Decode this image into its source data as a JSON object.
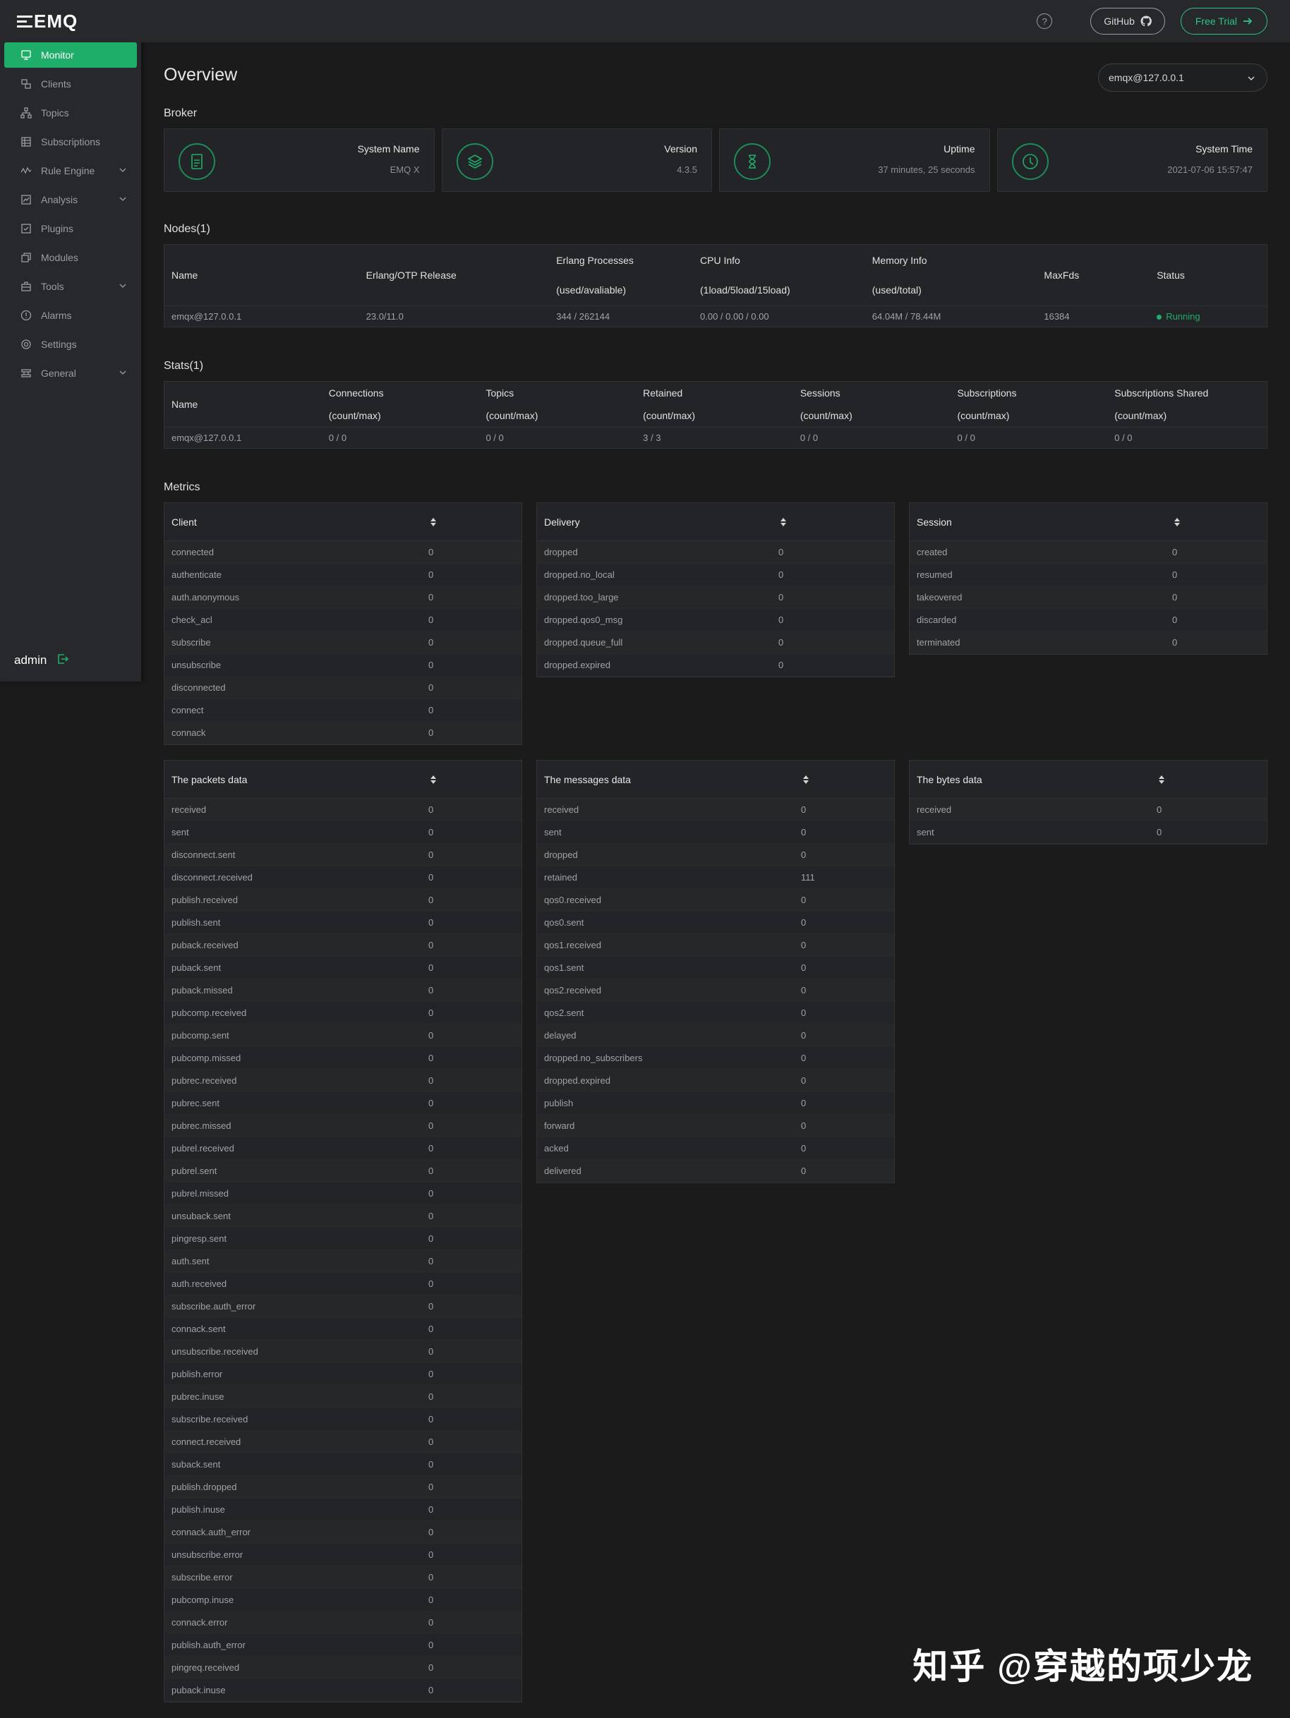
{
  "logo": "EMQ",
  "nav": [
    {
      "label": "Monitor",
      "icon": "monitor-icon",
      "active": true,
      "caret": false
    },
    {
      "label": "Clients",
      "icon": "clients-icon",
      "active": false,
      "caret": false
    },
    {
      "label": "Topics",
      "icon": "topics-icon",
      "active": false,
      "caret": false
    },
    {
      "label": "Subscriptions",
      "icon": "subscriptions-icon",
      "active": false,
      "caret": false
    },
    {
      "label": "Rule Engine",
      "icon": "rule-engine-icon",
      "active": false,
      "caret": true
    },
    {
      "label": "Analysis",
      "icon": "analysis-icon",
      "active": false,
      "caret": true
    },
    {
      "label": "Plugins",
      "icon": "plugins-icon",
      "active": false,
      "caret": false
    },
    {
      "label": "Modules",
      "icon": "modules-icon",
      "active": false,
      "caret": false
    },
    {
      "label": "Tools",
      "icon": "tools-icon",
      "active": false,
      "caret": true
    },
    {
      "label": "Alarms",
      "icon": "alarms-icon",
      "active": false,
      "caret": false
    },
    {
      "label": "Settings",
      "icon": "settings-icon",
      "active": false,
      "caret": false
    },
    {
      "label": "General",
      "icon": "general-icon",
      "active": false,
      "caret": true
    }
  ],
  "user": {
    "name": "admin",
    "logout_icon": "logout-icon"
  },
  "topbar": {
    "help": "?",
    "github": "GitHub",
    "trial": "Free Trial"
  },
  "page": {
    "title": "Overview",
    "node": "emqx@127.0.0.1"
  },
  "broker": {
    "label": "Broker",
    "cards": [
      {
        "label": "System Name",
        "value": "EMQ X",
        "icon": "document-icon"
      },
      {
        "label": "Version",
        "value": "4.3.5",
        "icon": "layers-icon"
      },
      {
        "label": "Uptime",
        "value": "37 minutes, 25 seconds",
        "icon": "hourglass-icon"
      },
      {
        "label": "System Time",
        "value": "2021-07-06 15:57:47",
        "icon": "clock-icon"
      }
    ]
  },
  "nodes": {
    "label": "Nodes(1)",
    "headers": [
      [
        "Name"
      ],
      [
        "Erlang/OTP Release"
      ],
      [
        "Erlang Processes",
        "(used/avaliable)"
      ],
      [
        "CPU Info",
        "(1load/5load/15load)"
      ],
      [
        "Memory Info",
        "(used/total)"
      ],
      [
        "MaxFds"
      ],
      [
        "Status"
      ]
    ],
    "rows": [
      [
        "emqx@127.0.0.1",
        "23.0/11.0",
        "344 / 262144",
        "0.00 / 0.00 / 0.00",
        "64.04M / 78.44M",
        "16384",
        "Running"
      ]
    ]
  },
  "stats": {
    "label": "Stats(1)",
    "headers": [
      [
        "Name"
      ],
      [
        "Connections",
        "(count/max)"
      ],
      [
        "Topics",
        "(count/max)"
      ],
      [
        "Retained",
        "(count/max)"
      ],
      [
        "Sessions",
        "(count/max)"
      ],
      [
        "Subscriptions",
        "(count/max)"
      ],
      [
        "Subscriptions Shared",
        "(count/max)"
      ]
    ],
    "rows": [
      [
        "emqx@127.0.0.1",
        "0 / 0",
        "0 / 0",
        "3 / 3",
        "0 / 0",
        "0 / 0",
        "0 / 0"
      ]
    ]
  },
  "metrics_label": "Metrics",
  "metrics": [
    {
      "title": "Client",
      "rows": [
        [
          "connected",
          "0"
        ],
        [
          "authenticate",
          "0"
        ],
        [
          "auth.anonymous",
          "0"
        ],
        [
          "check_acl",
          "0"
        ],
        [
          "subscribe",
          "0"
        ],
        [
          "unsubscribe",
          "0"
        ],
        [
          "disconnected",
          "0"
        ],
        [
          "connect",
          "0"
        ],
        [
          "connack",
          "0"
        ]
      ]
    },
    {
      "title": "Delivery",
      "rows": [
        [
          "dropped",
          "0"
        ],
        [
          "dropped.no_local",
          "0"
        ],
        [
          "dropped.too_large",
          "0"
        ],
        [
          "dropped.qos0_msg",
          "0"
        ],
        [
          "dropped.queue_full",
          "0"
        ],
        [
          "dropped.expired",
          "0"
        ]
      ]
    },
    {
      "title": "Session",
      "rows": [
        [
          "created",
          "0"
        ],
        [
          "resumed",
          "0"
        ],
        [
          "takeovered",
          "0"
        ],
        [
          "discarded",
          "0"
        ],
        [
          "terminated",
          "0"
        ]
      ]
    },
    {
      "title": "The packets data",
      "rows": [
        [
          "received",
          "0"
        ],
        [
          "sent",
          "0"
        ],
        [
          "disconnect.sent",
          "0"
        ],
        [
          "disconnect.received",
          "0"
        ],
        [
          "publish.received",
          "0"
        ],
        [
          "publish.sent",
          "0"
        ],
        [
          "puback.received",
          "0"
        ],
        [
          "puback.sent",
          "0"
        ],
        [
          "puback.missed",
          "0"
        ],
        [
          "pubcomp.received",
          "0"
        ],
        [
          "pubcomp.sent",
          "0"
        ],
        [
          "pubcomp.missed",
          "0"
        ],
        [
          "pubrec.received",
          "0"
        ],
        [
          "pubrec.sent",
          "0"
        ],
        [
          "pubrec.missed",
          "0"
        ],
        [
          "pubrel.received",
          "0"
        ],
        [
          "pubrel.sent",
          "0"
        ],
        [
          "pubrel.missed",
          "0"
        ],
        [
          "unsuback.sent",
          "0"
        ],
        [
          "pingresp.sent",
          "0"
        ],
        [
          "auth.sent",
          "0"
        ],
        [
          "auth.received",
          "0"
        ],
        [
          "subscribe.auth_error",
          "0"
        ],
        [
          "connack.sent",
          "0"
        ],
        [
          "unsubscribe.received",
          "0"
        ],
        [
          "publish.error",
          "0"
        ],
        [
          "pubrec.inuse",
          "0"
        ],
        [
          "subscribe.received",
          "0"
        ],
        [
          "connect.received",
          "0"
        ],
        [
          "suback.sent",
          "0"
        ],
        [
          "publish.dropped",
          "0"
        ],
        [
          "publish.inuse",
          "0"
        ],
        [
          "connack.auth_error",
          "0"
        ],
        [
          "unsubscribe.error",
          "0"
        ],
        [
          "subscribe.error",
          "0"
        ],
        [
          "pubcomp.inuse",
          "0"
        ],
        [
          "connack.error",
          "0"
        ],
        [
          "publish.auth_error",
          "0"
        ],
        [
          "pingreq.received",
          "0"
        ],
        [
          "puback.inuse",
          "0"
        ]
      ]
    },
    {
      "title": "The messages data",
      "rows": [
        [
          "received",
          "0"
        ],
        [
          "sent",
          "0"
        ],
        [
          "dropped",
          "0"
        ],
        [
          "retained",
          "111"
        ],
        [
          "qos0.received",
          "0"
        ],
        [
          "qos0.sent",
          "0"
        ],
        [
          "qos1.received",
          "0"
        ],
        [
          "qos1.sent",
          "0"
        ],
        [
          "qos2.received",
          "0"
        ],
        [
          "qos2.sent",
          "0"
        ],
        [
          "delayed",
          "0"
        ],
        [
          "dropped.no_subscribers",
          "0"
        ],
        [
          "dropped.expired",
          "0"
        ],
        [
          "publish",
          "0"
        ],
        [
          "forward",
          "0"
        ],
        [
          "acked",
          "0"
        ],
        [
          "delivered",
          "0"
        ]
      ]
    },
    {
      "title": "The bytes data",
      "rows": [
        [
          "received",
          "0"
        ],
        [
          "sent",
          "0"
        ]
      ]
    }
  ],
  "watermark": "知乎 @穿越的项少龙",
  "colors": {
    "accent": "#1fad6a",
    "trial": "#2fc383",
    "bg": "#1b1b1c",
    "panel": "#232427"
  }
}
